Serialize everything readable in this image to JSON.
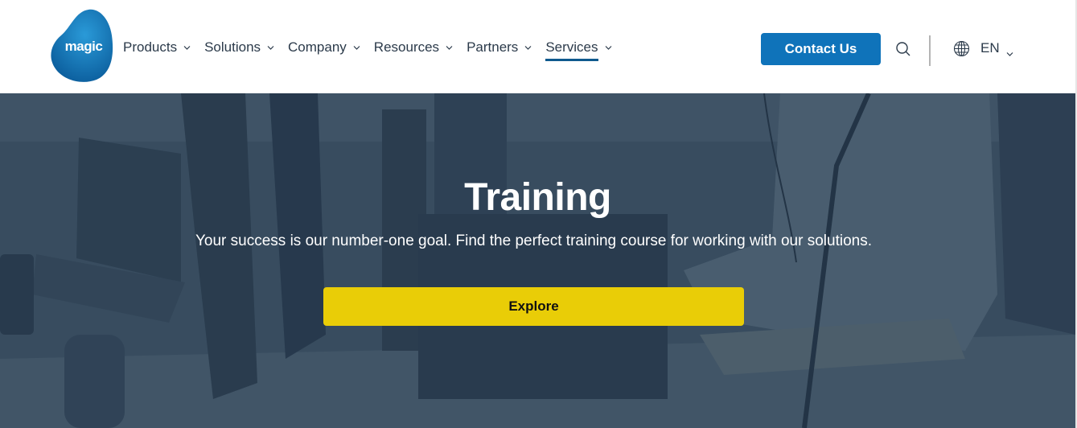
{
  "brand": {
    "logo_text": "magic",
    "logo_color": "#1277bd"
  },
  "nav": {
    "items": [
      {
        "label": "Products",
        "active": false
      },
      {
        "label": "Solutions",
        "active": false
      },
      {
        "label": "Company",
        "active": false
      },
      {
        "label": "Resources",
        "active": false
      },
      {
        "label": "Partners",
        "active": false
      },
      {
        "label": "Services",
        "active": true
      }
    ],
    "contact_label": "Contact Us",
    "search_icon": "search-icon",
    "language_icon": "globe-icon",
    "language": "EN"
  },
  "hero": {
    "title": "Training",
    "subtitle": "Your success is our number-one goal. Find the perfect training course for working with our solutions.",
    "cta_label": "Explore"
  },
  "colors": {
    "primary": "#0f73ba",
    "active_underline": "#0f5a8e",
    "cta": "#e9cd07",
    "hero_overlay": "#2c3e52"
  }
}
